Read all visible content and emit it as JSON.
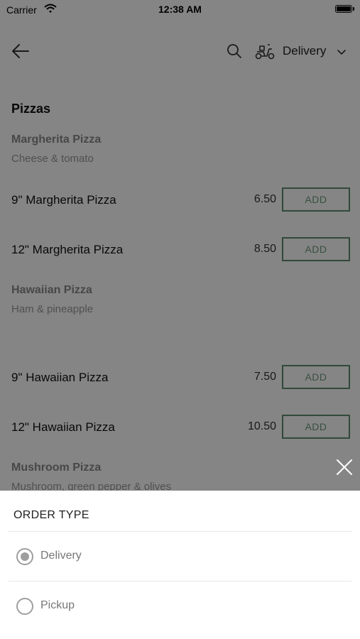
{
  "status": {
    "carrier": "Carrier",
    "time": "12:38 AM"
  },
  "nav": {
    "order_type_label": "Delivery"
  },
  "menu": {
    "section_title": "Pizzas",
    "add_label": "ADD",
    "groups": [
      {
        "title": "Margherita Pizza",
        "desc": "Cheese & tomato",
        "items": [
          {
            "name": "9\" Margherita Pizza",
            "price": "6.50"
          },
          {
            "name": "12\" Margherita Pizza",
            "price": "8.50"
          }
        ]
      },
      {
        "title": "Hawaiian Pizza",
        "desc": "Ham & pineapple",
        "items": [
          {
            "name": "9\" Hawaiian Pizza",
            "price": "7.50"
          },
          {
            "name": "12\" Hawaiian Pizza",
            "price": "10.50"
          }
        ]
      },
      {
        "title": "Mushroom Pizza",
        "desc": "Mushroom, green pepper & olives",
        "items": []
      }
    ]
  },
  "sheet": {
    "title": "ORDER TYPE",
    "options": [
      {
        "label": "Delivery",
        "selected": true
      },
      {
        "label": "Pickup",
        "selected": false
      }
    ]
  },
  "colors": {
    "add_border": "#5f8c6f",
    "overlay": "rgba(0,0,0,0.48)"
  }
}
